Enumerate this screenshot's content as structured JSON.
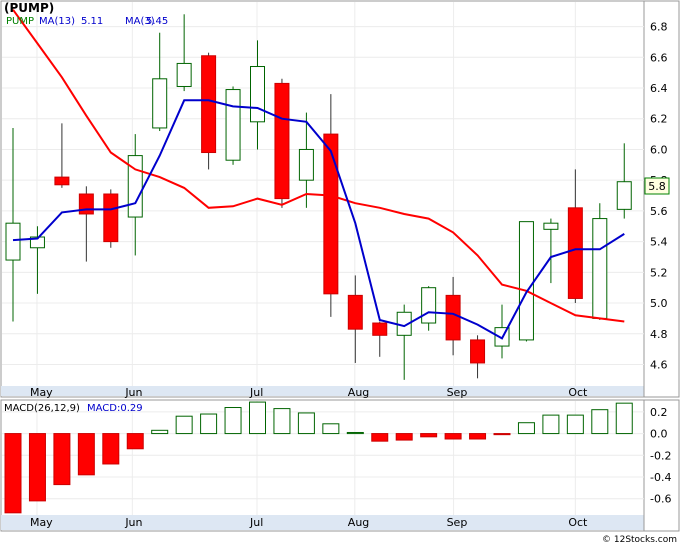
{
  "chart_data": [
    {
      "type": "candlestick",
      "title": "(PUMP)",
      "legend": [
        {
          "text": "PUMP",
          "color": "#008000"
        },
        {
          "text": "MA(13)",
          "color": "#0000cc"
        },
        {
          "text": "5.11",
          "color": "#0000cc"
        },
        {
          "text": "MA(3)",
          "color": "#0000cc"
        },
        {
          "text": "5.45",
          "color": "#0000cc"
        }
      ],
      "last_price_label": "5.8",
      "yticks": [
        "4.6",
        "4.8",
        "5.0",
        "5.2",
        "5.4",
        "5.6",
        "5.8",
        "6.0",
        "6.2",
        "6.4",
        "6.6",
        "6.8"
      ],
      "ylim": [
        4.46,
        6.96
      ],
      "xticks": [
        "May",
        "Jun",
        "Jul",
        "Aug",
        "Sep",
        "Oct"
      ],
      "x": [
        "Apr 25",
        "May 2",
        "May 9",
        "May 16",
        "May 23",
        "May 30",
        "Jun 6",
        "Jun 13",
        "Jun 20",
        "Jun 27",
        "Jul 4",
        "Jul 11",
        "Jul 18",
        "Jul 25",
        "Aug 1",
        "Aug 8",
        "Aug 15",
        "Aug 22",
        "Aug 29",
        "Sep 5",
        "Sep 12",
        "Sep 19",
        "Sep 26",
        "Oct 3",
        "Oct 10",
        "Oct 17"
      ],
      "ohlc": [
        [
          5.28,
          6.14,
          4.88,
          5.52
        ],
        [
          5.36,
          5.5,
          5.06,
          5.43
        ],
        [
          5.82,
          6.17,
          5.75,
          5.77
        ],
        [
          5.71,
          5.76,
          5.27,
          5.58
        ],
        [
          5.71,
          5.74,
          5.36,
          5.4
        ],
        [
          5.56,
          6.1,
          5.31,
          5.96
        ],
        [
          6.14,
          6.76,
          6.12,
          6.46
        ],
        [
          6.41,
          6.88,
          6.38,
          6.56
        ],
        [
          6.61,
          6.63,
          5.87,
          5.98
        ],
        [
          5.93,
          6.41,
          5.9,
          6.39
        ],
        [
          6.18,
          6.71,
          6.0,
          6.54
        ],
        [
          6.43,
          6.46,
          5.62,
          5.68
        ],
        [
          5.8,
          6.24,
          5.62,
          6.0
        ],
        [
          6.1,
          6.36,
          4.91,
          5.06
        ],
        [
          5.05,
          5.18,
          4.61,
          4.83
        ],
        [
          4.87,
          4.88,
          4.65,
          4.79
        ],
        [
          4.79,
          4.99,
          4.5,
          4.94
        ],
        [
          4.87,
          5.11,
          4.82,
          5.1
        ],
        [
          5.05,
          5.17,
          4.66,
          4.76
        ],
        [
          4.76,
          4.79,
          4.51,
          4.61
        ],
        [
          4.72,
          4.99,
          4.64,
          4.84
        ],
        [
          4.76,
          5.53,
          4.75,
          5.53
        ],
        [
          5.48,
          5.55,
          5.13,
          5.52
        ],
        [
          5.62,
          5.87,
          5.0,
          5.03
        ],
        [
          4.9,
          5.65,
          4.89,
          5.55
        ],
        [
          5.61,
          6.04,
          5.55,
          5.79
        ]
      ],
      "series": [
        {
          "name": "MA(13)",
          "color": "#ff0000",
          "values": [
            6.91,
            6.69,
            6.47,
            6.22,
            5.98,
            5.87,
            5.82,
            5.75,
            5.62,
            5.63,
            5.68,
            5.64,
            5.71,
            5.7,
            5.65,
            5.62,
            5.58,
            5.55,
            5.46,
            5.31,
            5.12,
            5.08,
            5.0,
            4.92,
            4.9,
            4.88
          ]
        },
        {
          "name": "MA(3)",
          "color": "#0000cc",
          "values": [
            5.41,
            5.42,
            5.59,
            5.61,
            5.61,
            5.65,
            5.96,
            6.32,
            6.32,
            6.28,
            6.27,
            6.2,
            6.18,
            5.99,
            5.52,
            4.89,
            4.85,
            4.94,
            4.93,
            4.86,
            4.77,
            5.07,
            5.3,
            5.35,
            5.35,
            5.45
          ]
        }
      ]
    },
    {
      "type": "bar",
      "title": "MACD(26,12,9)",
      "legend": [
        {
          "text": "MACD(26,12,9)",
          "color": "#000000"
        },
        {
          "text": "MACD:0.29",
          "color": "#0000cc"
        }
      ],
      "yticks": [
        "0.2",
        "0.0",
        "-0.2",
        "-0.4",
        "-0.6"
      ],
      "ylim": [
        -0.75,
        0.3
      ],
      "xticks": [
        "May",
        "Jun",
        "Jul",
        "Aug",
        "Sep",
        "Oct"
      ],
      "values": [
        -0.73,
        -0.62,
        -0.47,
        -0.38,
        -0.28,
        -0.14,
        0.03,
        0.16,
        0.18,
        0.24,
        0.29,
        0.23,
        0.19,
        0.09,
        0.01,
        -0.07,
        -0.06,
        -0.03,
        -0.05,
        -0.05,
        -0.01,
        0.1,
        0.17,
        0.17,
        0.22,
        0.28
      ]
    }
  ],
  "footer": "© 12Stocks.com"
}
